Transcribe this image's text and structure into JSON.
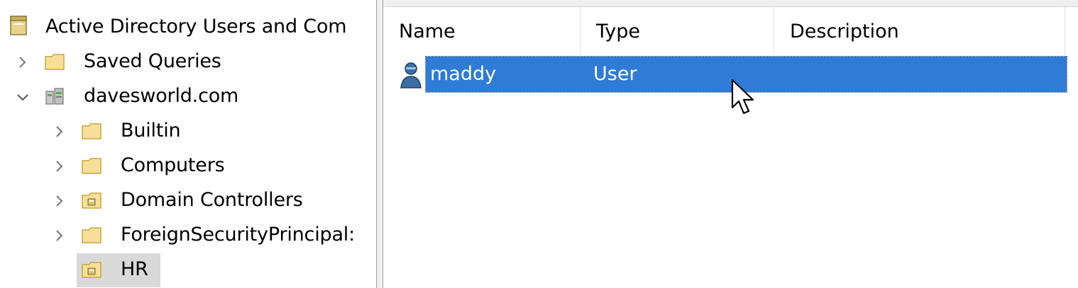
{
  "tree": {
    "root": {
      "label": "Active Directory Users and Com"
    },
    "items": [
      {
        "label": "Saved Queries"
      },
      {
        "label": "davesworld.com"
      },
      {
        "label": "Builtin"
      },
      {
        "label": "Computers"
      },
      {
        "label": "Domain Controllers"
      },
      {
        "label": "ForeignSecurityPrincipal:"
      },
      {
        "label": "HR"
      }
    ]
  },
  "list": {
    "columns": [
      "Name",
      "Type",
      "Description"
    ],
    "rows": [
      {
        "name": "maddy",
        "type": "User",
        "description": ""
      }
    ]
  },
  "colors": {
    "selection": "#2f7bd6",
    "tree_selection": "#d9d9d9"
  }
}
